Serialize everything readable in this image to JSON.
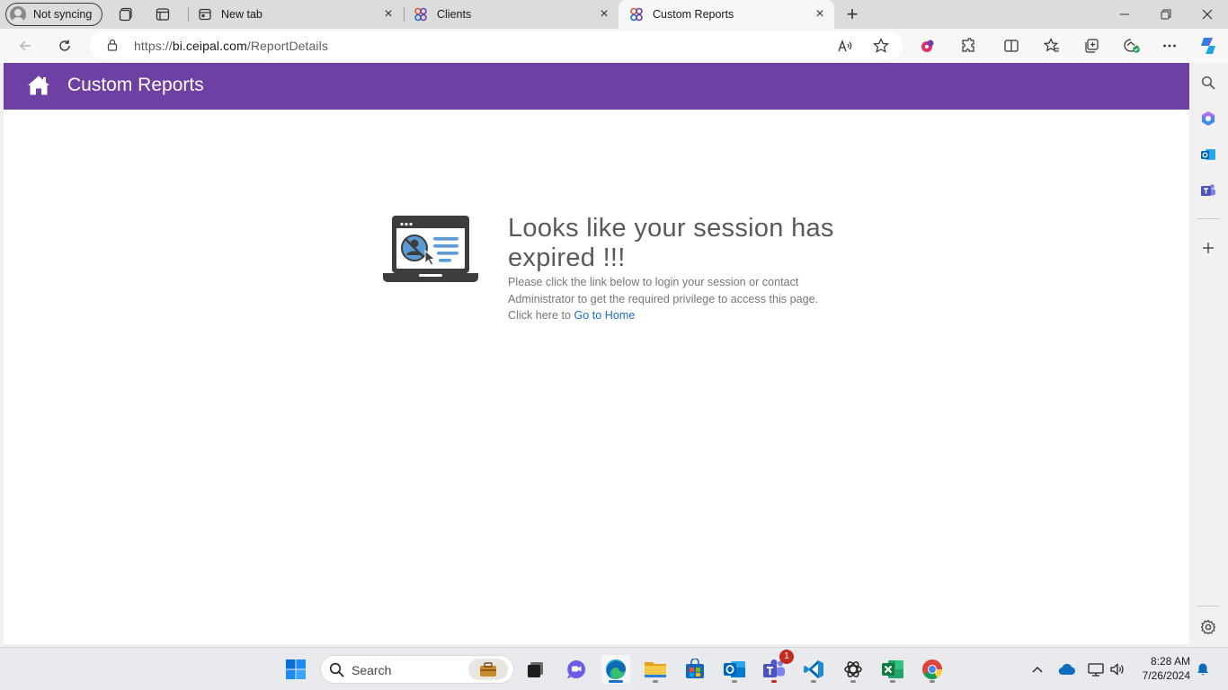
{
  "browser": {
    "profile_label": "Not syncing",
    "tabs": [
      {
        "label": "New tab"
      },
      {
        "label": "Clients"
      },
      {
        "label": "Custom Reports"
      }
    ],
    "url_prefix": "https://",
    "url_host": "bi.ceipal.com",
    "url_path": "/ReportDetails"
  },
  "page": {
    "header_title": "Custom Reports",
    "message_title": "Looks like your session has expired !!!",
    "message_body": "Please click the link below to login your session or contact Administrator to get the required privilege to access this page.",
    "click_here_text": "Click here to",
    "home_link_text": "Go to Home",
    "brand_color": "#6f40a4"
  },
  "taskbar": {
    "search_label": "Search",
    "teams_badge": "1",
    "time": "8:28 AM",
    "date": "7/26/2024"
  }
}
